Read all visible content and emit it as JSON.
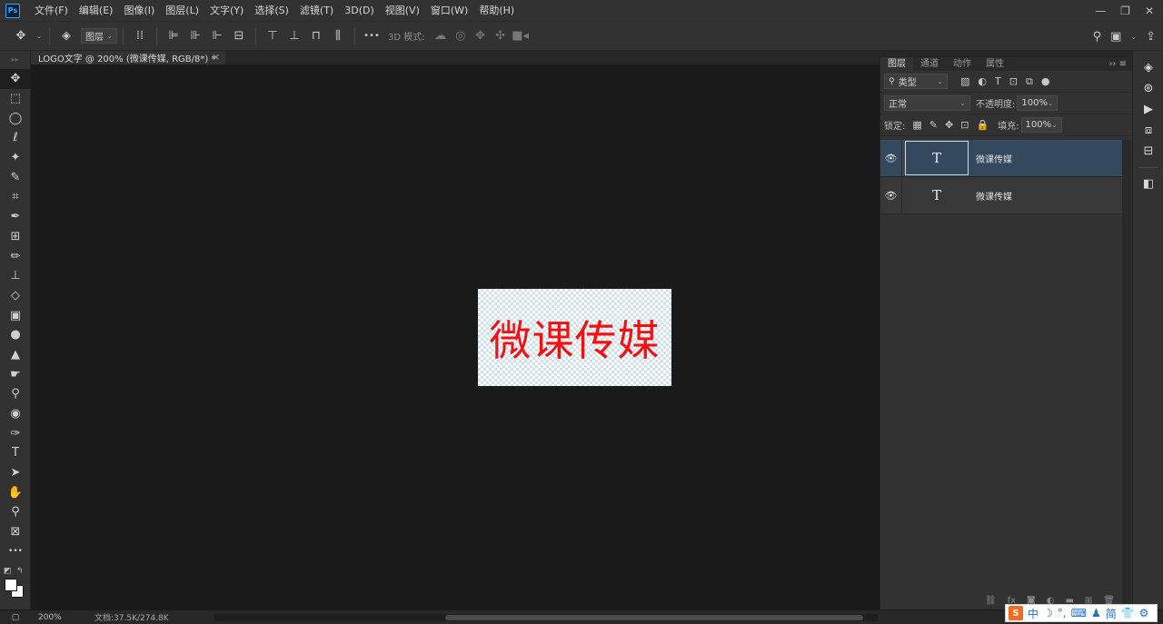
{
  "app": {
    "logo": "Ps",
    "menus": [
      "文件(F)",
      "编辑(E)",
      "图像(I)",
      "图层(L)",
      "文字(Y)",
      "选择(S)",
      "滤镜(T)",
      "3D(D)",
      "视图(V)",
      "窗口(W)",
      "帮助(H)"
    ]
  },
  "window_controls": {
    "minimize": "—",
    "restore": "❐",
    "close": "✕"
  },
  "options_bar": {
    "move_tool_icon": "✥",
    "layer_select_label": "图层",
    "mode_3d_label": "3D 模式:",
    "more_label": "•••"
  },
  "document": {
    "tab_title": "LOGO文字 @ 200% (微课传媒, RGB/8*) *",
    "close": "×",
    "canvas_text": "微课传媒",
    "text_color": "#f21111"
  },
  "toolbar": {
    "tools": [
      {
        "name": "move-tool",
        "glyph": "✥"
      },
      {
        "name": "marquee-tool",
        "glyph": "⬚"
      },
      {
        "name": "elliptical-marquee-tool",
        "glyph": "◯"
      },
      {
        "name": "lasso-tool",
        "glyph": "ℓ"
      },
      {
        "name": "magic-wand-tool",
        "glyph": "✦"
      },
      {
        "name": "quick-selection-tool",
        "glyph": "✎"
      },
      {
        "name": "crop-tool",
        "glyph": "⌗"
      },
      {
        "name": "eyedropper-tool",
        "glyph": "✒"
      },
      {
        "name": "spot-healing-tool",
        "glyph": "⊞"
      },
      {
        "name": "brush-tool",
        "glyph": "✏"
      },
      {
        "name": "clone-stamp-tool",
        "glyph": "⊥"
      },
      {
        "name": "eraser-tool",
        "glyph": "◇"
      },
      {
        "name": "gradient-tool",
        "glyph": "▣"
      },
      {
        "name": "blur-tool",
        "glyph": "●"
      },
      {
        "name": "sharpen-tool",
        "glyph": "▲"
      },
      {
        "name": "smudge-tool",
        "glyph": "☛"
      },
      {
        "name": "dodge-tool",
        "glyph": "⚲"
      },
      {
        "name": "sponge-tool",
        "glyph": "◉"
      },
      {
        "name": "pen-tool",
        "glyph": "✑"
      },
      {
        "name": "type-tool",
        "glyph": "T"
      },
      {
        "name": "path-selection-tool",
        "glyph": "➤"
      },
      {
        "name": "hand-tool",
        "glyph": "✋"
      },
      {
        "name": "zoom-tool",
        "glyph": "⚲"
      },
      {
        "name": "frame-tool",
        "glyph": "⊠"
      },
      {
        "name": "more-tools",
        "glyph": "•••"
      }
    ],
    "foreground_color": "#ffffff",
    "background_color": "#ffffff"
  },
  "status_bar": {
    "zoom": "200%",
    "doc_info": "文档:37.5K/274.8K",
    "arrow": "›",
    "back_arrow": "‹"
  },
  "layers_panel": {
    "tabs": [
      "图层",
      "通道",
      "动作",
      "属性"
    ],
    "active_tab": "图层",
    "filter_type": "类型",
    "blend_mode": "正常",
    "opacity_label": "不透明度:",
    "opacity_value": "100%",
    "lock_label": "锁定:",
    "fill_label": "填充:",
    "fill_value": "100%",
    "layers": [
      {
        "name": "微课传媒",
        "type_glyph": "T",
        "visible": true,
        "selected": true
      },
      {
        "name": "微课传媒",
        "type_glyph": "T",
        "visible": true,
        "selected": false
      }
    ],
    "footer_icons": [
      "link-icon",
      "fx-icon",
      "mask-icon",
      "adjustment-icon",
      "group-icon",
      "new-layer-icon",
      "trash-icon"
    ]
  },
  "ime_bar": {
    "logo": "S",
    "items": [
      "中",
      "☽",
      "°,",
      "⌨",
      "♟",
      "简",
      "👕",
      "⚙"
    ]
  }
}
